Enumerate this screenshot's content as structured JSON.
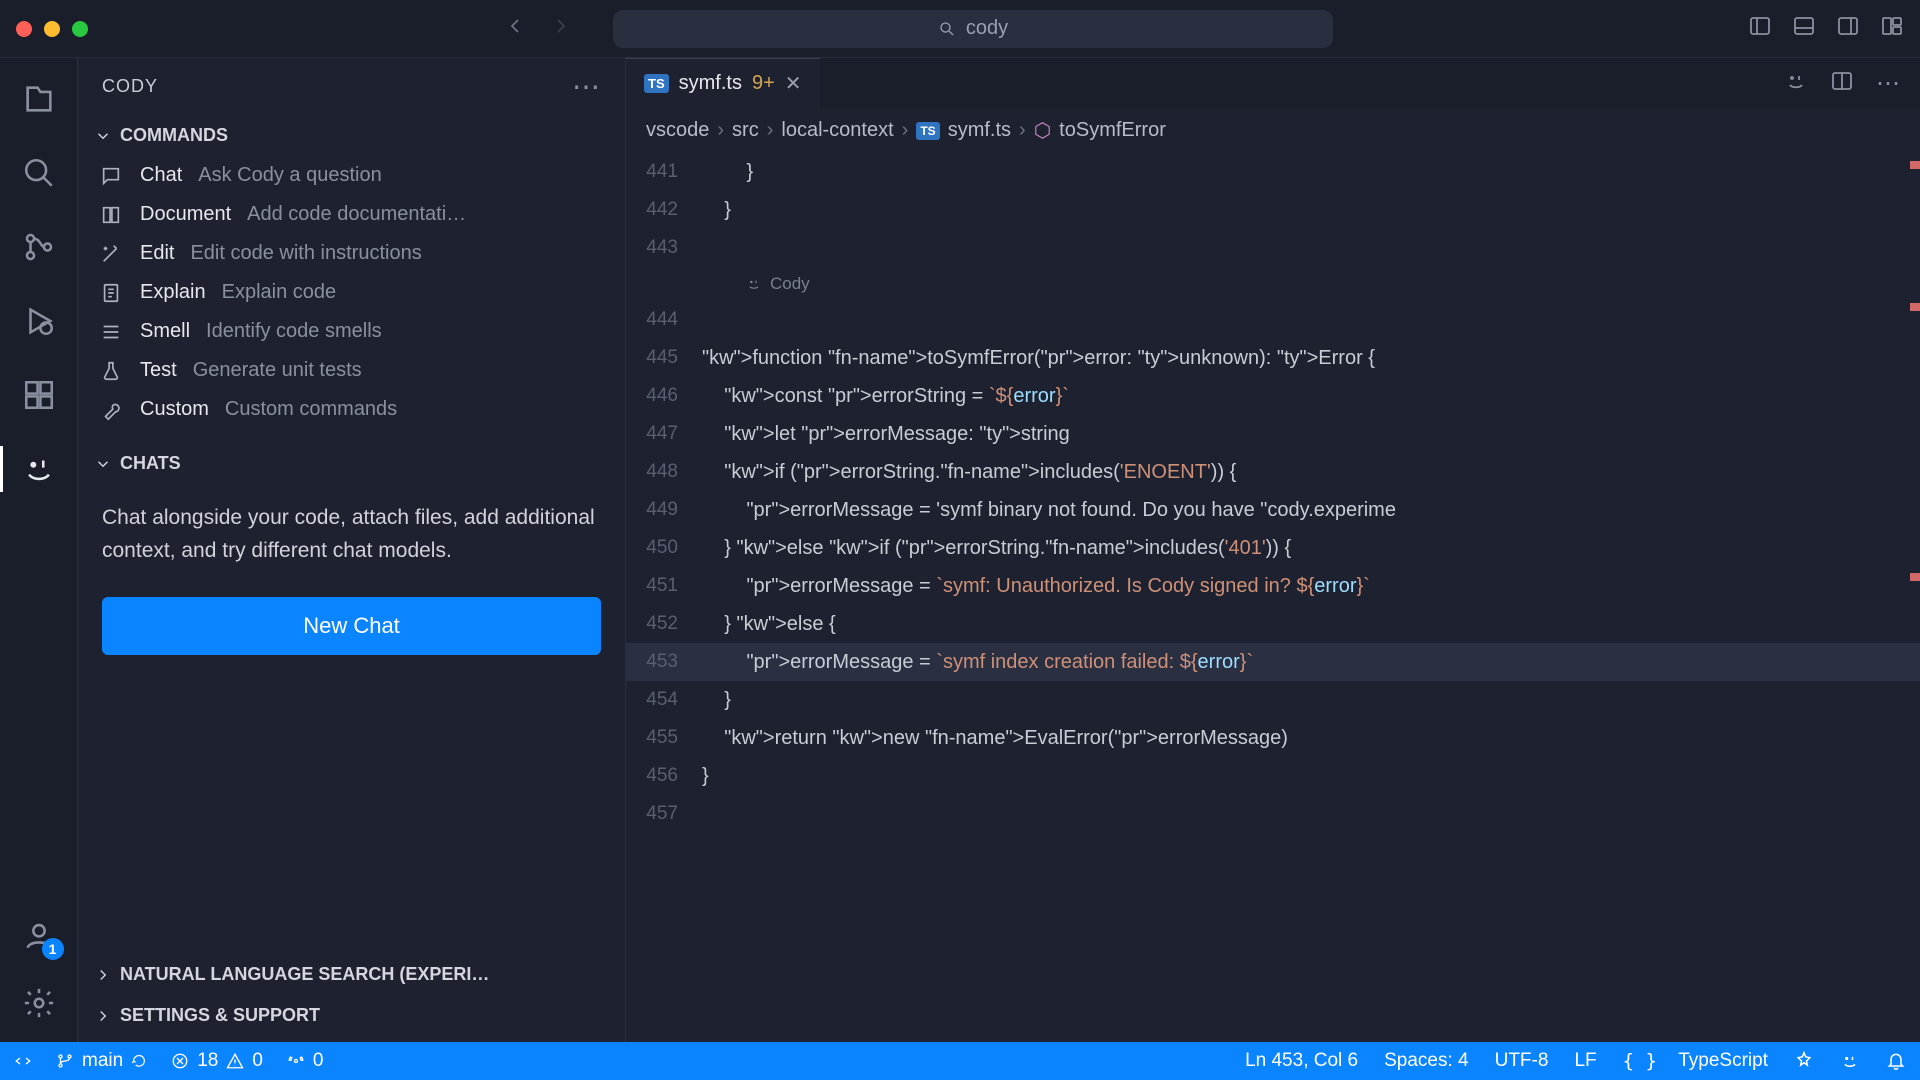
{
  "titlebar": {
    "search": "cody"
  },
  "activity_badge": "1",
  "sidebar": {
    "title": "CODY",
    "commands_header": "COMMANDS",
    "commands": [
      {
        "name": "Chat",
        "desc": "Ask Cody a question",
        "icon": "chat"
      },
      {
        "name": "Document",
        "desc": "Add code documentati…",
        "icon": "book"
      },
      {
        "name": "Edit",
        "desc": "Edit code with instructions",
        "icon": "wand"
      },
      {
        "name": "Explain",
        "desc": "Explain code",
        "icon": "file"
      },
      {
        "name": "Smell",
        "desc": "Identify code smells",
        "icon": "list"
      },
      {
        "name": "Test",
        "desc": "Generate unit tests",
        "icon": "beaker"
      },
      {
        "name": "Custom",
        "desc": "Custom commands",
        "icon": "tools"
      }
    ],
    "chats_header": "CHATS",
    "chats_desc": "Chat alongside your code, attach files, add additional context, and try different chat models.",
    "new_chat": "New Chat",
    "nls_header": "NATURAL LANGUAGE SEARCH (EXPERI…",
    "settings_header": "SETTINGS & SUPPORT"
  },
  "tab": {
    "file": "symf.ts",
    "modified": "9+"
  },
  "breadcrumbs": [
    "vscode",
    "src",
    "local-context",
    "symf.ts",
    "toSymfError"
  ],
  "codelens": "Cody",
  "status": {
    "remote": "main",
    "errors": "18",
    "warnings": "0",
    "port": "0",
    "pos": "Ln 453, Col 6",
    "spaces": "Spaces: 4",
    "enc": "UTF-8",
    "eol": "LF",
    "lang": "TypeScript"
  },
  "code": {
    "start": 441,
    "highlight": 453,
    "lines": [
      "        }",
      "    }",
      "",
      "",
      "function toSymfError(error: unknown): Error {",
      "    const errorString = `${error}`",
      "    let errorMessage: string",
      "    if (errorString.includes('ENOENT')) {",
      "        errorMessage = 'symf binary not found. Do you have \"cody.experime",
      "    } else if (errorString.includes('401')) {",
      "        errorMessage = `symf: Unauthorized. Is Cody signed in? ${error}`",
      "    } else {",
      "        errorMessage = `symf index creation failed: ${error}`",
      "    }",
      "    return new EvalError(errorMessage)",
      "}",
      ""
    ]
  }
}
